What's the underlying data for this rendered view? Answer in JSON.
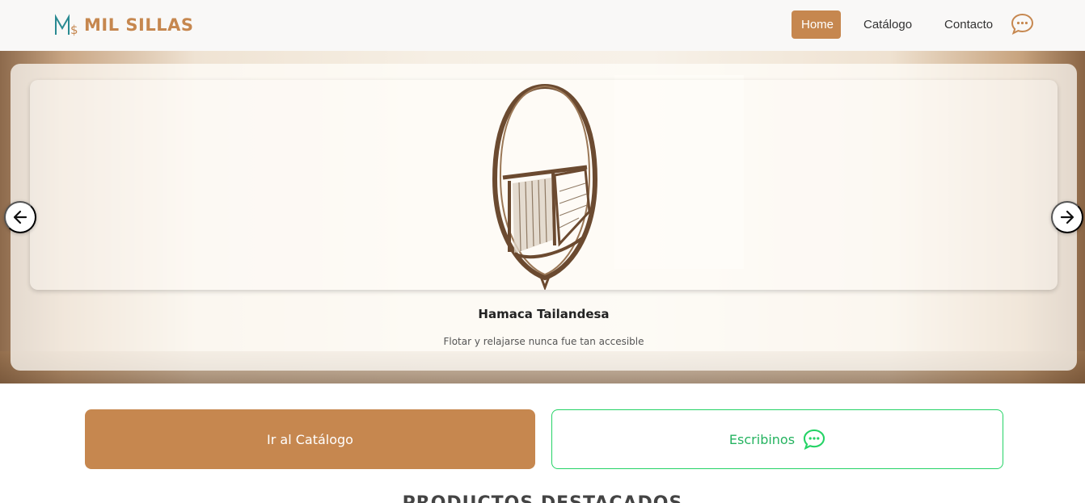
{
  "brand": {
    "name": "MIL SILLAS",
    "color": "#c6874f"
  },
  "nav": {
    "items": [
      {
        "label": "Home",
        "active": true
      },
      {
        "label": "Catálogo",
        "active": false
      },
      {
        "label": "Contacto",
        "active": false
      }
    ],
    "chat_icon": "chat-bubble-icon"
  },
  "hero": {
    "slide": {
      "title": "Hamaca Tailandesa",
      "subtitle": "Flotar y relajarse nunca fue tan accesible"
    },
    "prev_icon": "arrow-left-icon",
    "next_icon": "arrow-right-icon"
  },
  "actions": {
    "catalog_label": "Ir al Catálogo",
    "write_label": "Escribinos",
    "whatsapp_color": "#25d366"
  },
  "featured": {
    "title": "PRODUCTOS DESTACADOS"
  }
}
